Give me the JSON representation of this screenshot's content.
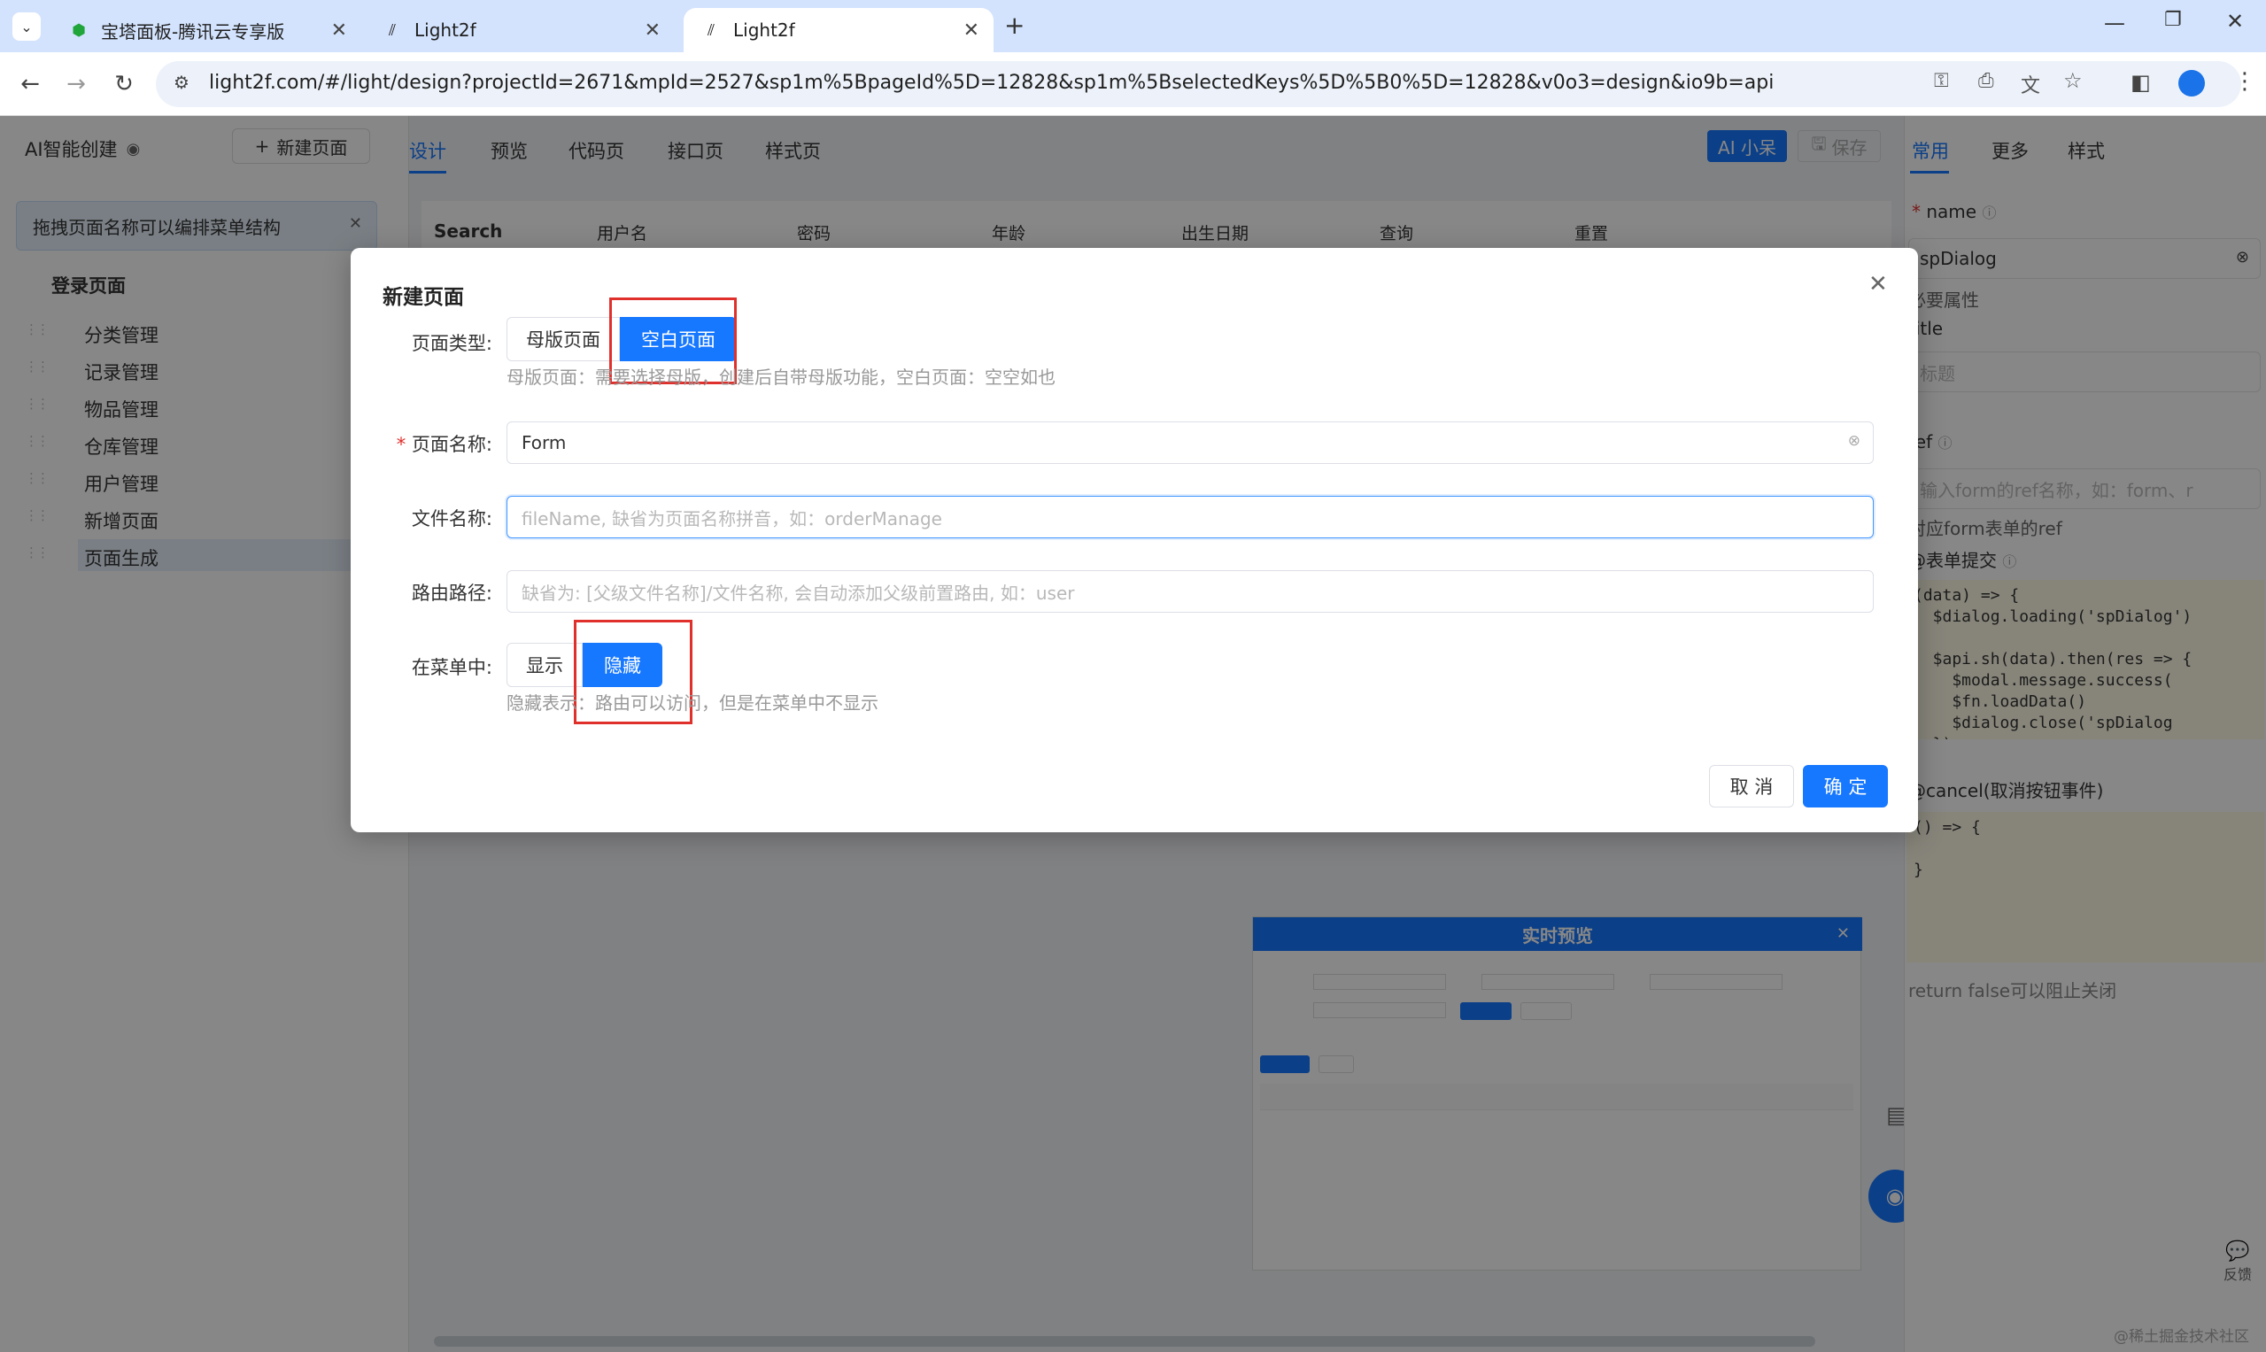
{
  "browser": {
    "tabs": [
      {
        "title": "宝塔面板-腾讯云专享版"
      },
      {
        "title": "Light2f"
      },
      {
        "title": "Light2f"
      }
    ],
    "url": "light2f.com/#/light/design?projectId=2671&mpId=2527&sp1m%5BpageId%5D=12828&sp1m%5BselectedKeys%5D%5B0%5D=12828&v0o3=design&io9b=api"
  },
  "sidebar": {
    "ai_title": "AI智能创建",
    "new_page_button": "新建页面",
    "tip": "拖拽页面名称可以编排菜单结构",
    "group_title": "登录页面",
    "items": [
      {
        "label": "分类管理"
      },
      {
        "label": "记录管理"
      },
      {
        "label": "物品管理"
      },
      {
        "label": "仓库管理"
      },
      {
        "label": "用户管理"
      },
      {
        "label": "新增页面"
      },
      {
        "label": "页面生成"
      }
    ]
  },
  "center": {
    "tabs": [
      "设计",
      "预览",
      "代码页",
      "接口页",
      "样式页"
    ],
    "ai_button": "AI 小呆",
    "save_button": "保存",
    "search_label": "Search",
    "columns": [
      "用户名",
      "密码",
      "年龄",
      "出生日期",
      "查询",
      "重置"
    ],
    "preview": {
      "title": "实时预览"
    }
  },
  "right_panel": {
    "tabs": [
      "常用",
      "更多",
      "样式"
    ],
    "name_label": "name",
    "name_value": "spDialog",
    "required_attr": "必要属性",
    "title_label": "title",
    "title_placeholder": "标题",
    "ref_label": "ref",
    "ref_placeholder": "输入form的ref名称，如：form、r",
    "ref_help": "对应form表单的ref",
    "submit_label": "@表单提交",
    "submit_code": "(data) => {\n  $dialog.loading('spDialog')\n\n  $api.sh(data).then(res => {\n    $modal.message.success(\n    $fn.loadData()\n    $dialog.close('spDialog\n  })",
    "cancel_label": "@cancel(取消按钮事件)",
    "cancel_code": "() => {\n\n}",
    "cancel_help": "return false可以阻止关闭",
    "feedback": "反馈",
    "watermark": "@稀土掘金技术社区"
  },
  "dialog": {
    "title": "新建页面",
    "page_type_label": "页面类型:",
    "page_type_options": [
      "母版页面",
      "空白页面"
    ],
    "page_type_selected": "空白页面",
    "page_type_help": "母版页面：需要选择母版，创建后自带母版功能，空白页面：空空如也",
    "page_name_label": "页面名称:",
    "page_name_value": "Form",
    "file_name_label": "文件名称:",
    "file_name_placeholder": "fileName, 缺省为页面名称拼音，如：orderManage",
    "route_label": "路由路径:",
    "route_placeholder": "缺省为: [父级文件名称]/文件名称, 会自动添加父级前置路由, 如：user",
    "menu_label": "在菜单中:",
    "menu_options": [
      "显示",
      "隐藏"
    ],
    "menu_selected": "隐藏",
    "menu_help": "隐藏表示：路由可以访问，但是在菜单中不显示",
    "cancel_button": "取 消",
    "ok_button": "确 定"
  },
  "colors": {
    "primary": "#1677ff",
    "highlight_box": "#e0302c"
  }
}
